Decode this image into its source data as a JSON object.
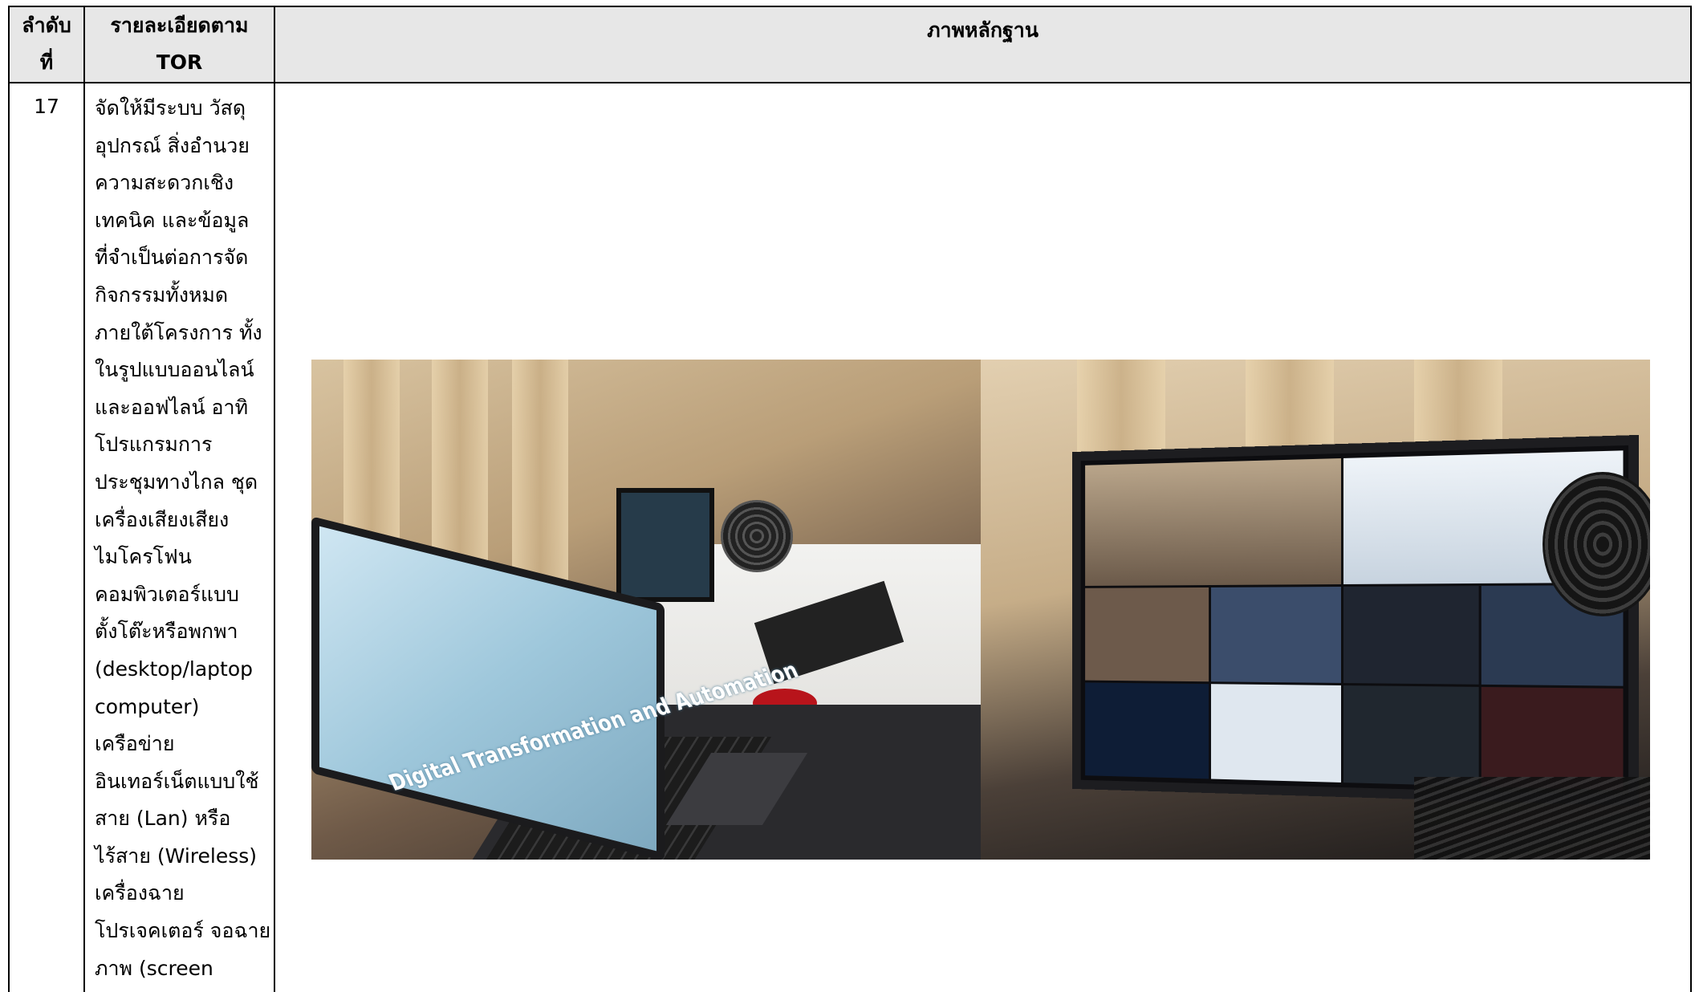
{
  "table": {
    "headers": {
      "seq_line1": "ลำดับ",
      "seq_line2": "ที่",
      "detail_line1": "รายละเอียดตาม",
      "detail_line2": "TOR",
      "evidence": "ภาพหลักฐาน"
    },
    "row": {
      "seq": "17",
      "detail_lines": [
        "จัดให้มีระบบ วัสดุ",
        "อุปกรณ์ สิ่งอำนวย",
        "ความสะดวกเชิง",
        "เทคนิค และข้อมูล",
        "ที่จำเป็นต่อการจัด",
        "กิจกรรมทั้งหมด",
        "ภายใต้โครงการ ทั้ง",
        "ในรูปแบบออนไลน์",
        "และออฟไลน์ อาทิ",
        "โปรแกรมการ",
        "ประชุมทางไกล ชุด",
        "เครื่องเสียงเสียง",
        "ไมโครโฟน",
        "คอมพิวเตอร์แบบ",
        "ตั้งโต๊ะหรือพกพา",
        "(desktop/laptop",
        "computer)",
        "เครือข่าย",
        "อินเทอร์เน็ตแบบใช้",
        "สาย (Lan) หรือ",
        "ไร้สาย (Wireless)",
        "เครื่องฉาย",
        "โปรเจคเตอร์ จอฉาย",
        "ภาพ (screen"
      ]
    },
    "photos": {
      "left": {
        "laptop_screen_text": "Digital Transformation and Automation"
      },
      "right": {}
    }
  }
}
